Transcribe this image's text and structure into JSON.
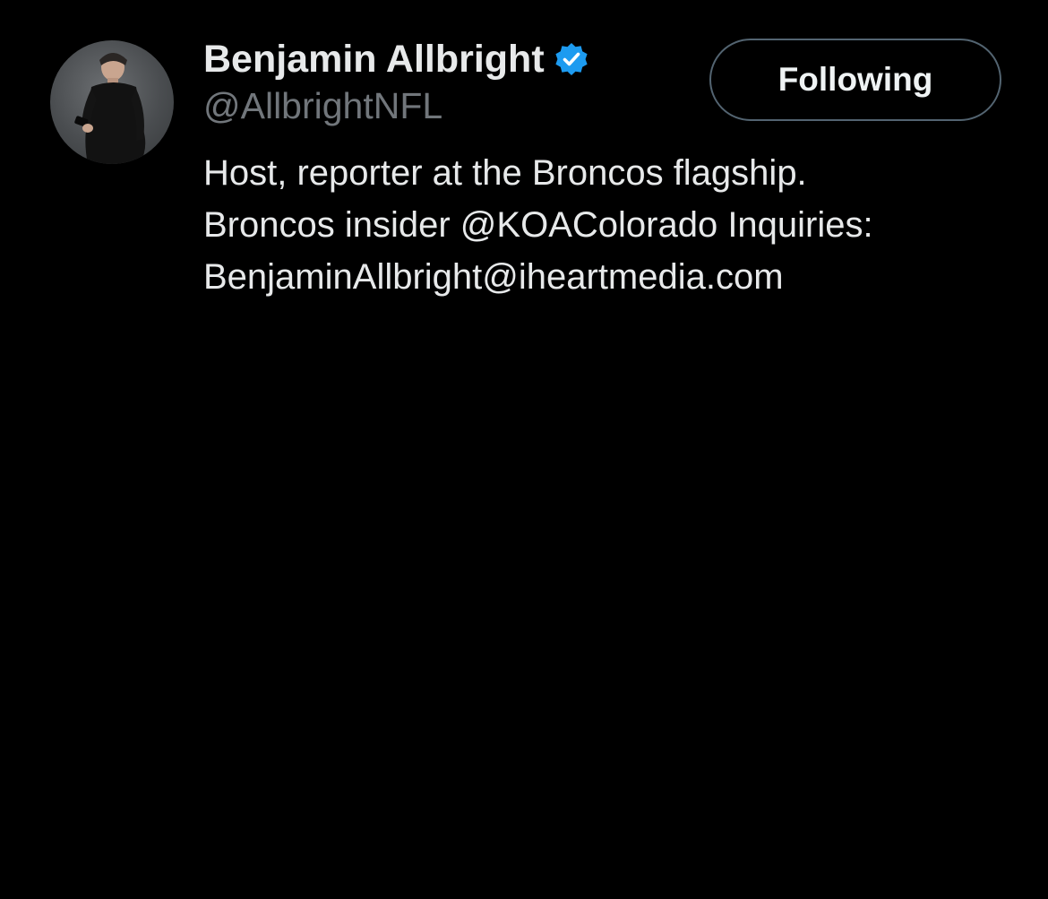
{
  "profile": {
    "display_name": "Benjamin Allbright",
    "handle": "@AllbrightNFL",
    "verified_icon": "verified-badge-icon",
    "avatar_icon": "profile-photo",
    "bio_lines": [
      "Host, reporter at the Broncos flagship.",
      "Broncos insider @KOAColorado Inquiries:",
      "BenjaminAllbright@iheartmedia.com"
    ]
  },
  "actions": {
    "follow_label": "Following"
  },
  "colors": {
    "background": "#000000",
    "primary_text": "#e7e9ea",
    "secondary_text": "#71767b",
    "verified": "#1d9bf0",
    "button_border": "#536471"
  }
}
